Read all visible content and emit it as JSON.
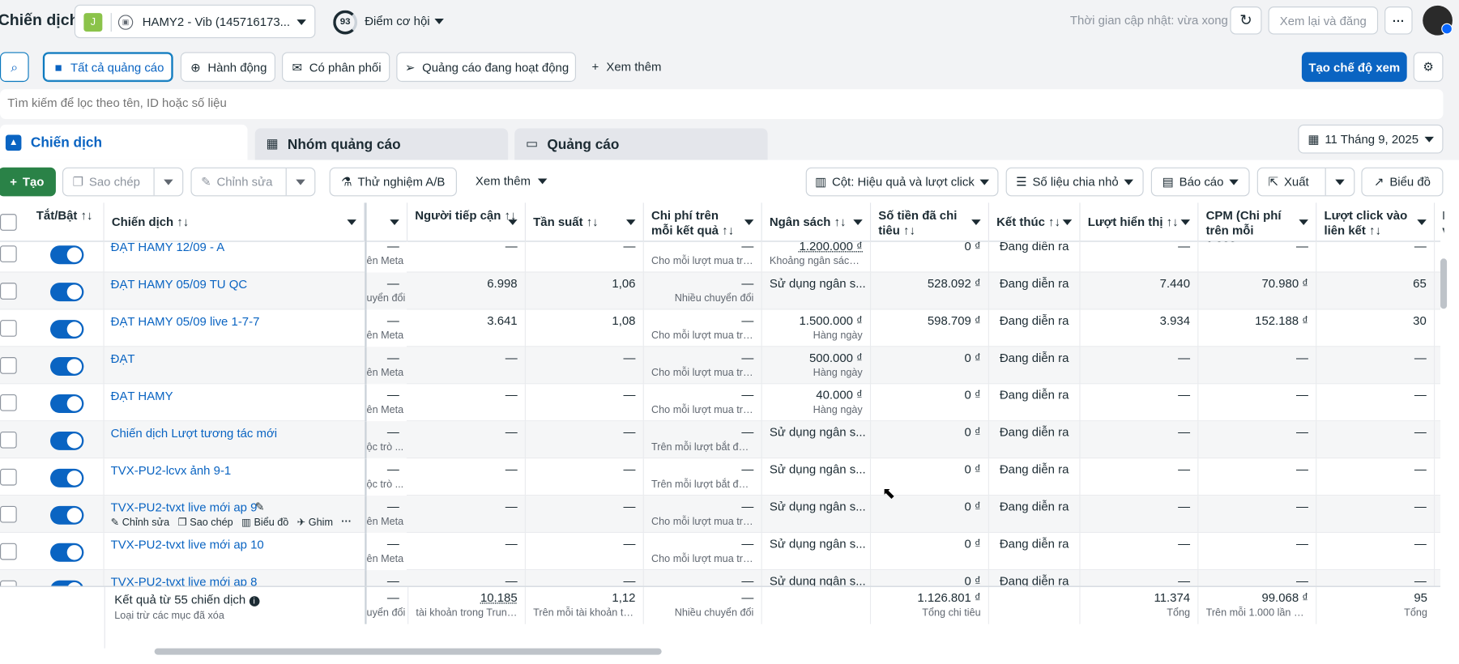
{
  "header": {
    "title": "Chiến dịch",
    "account_initial": "J",
    "account_name": "HAMY2 - Vib (145716173...",
    "score": "93",
    "opportunity_label": "Điểm cơ hội",
    "update_status": "Thời gian cập nhật: vừa xong",
    "review_button": "Xem lại và đăng",
    "more_button": "···"
  },
  "filters": {
    "all_ads": "Tất cả quảng cáo",
    "actions": "Hành động",
    "delivery": "Có phân phối",
    "active_ads": "Quảng cáo đang hoạt động",
    "see_more": "Xem thêm",
    "create_view": "Tạo chế độ xem"
  },
  "search": {
    "placeholder": "Tìm kiếm để lọc theo tên, ID hoặc số liệu"
  },
  "tabs": {
    "campaigns": "Chiến dịch",
    "ad_sets": "Nhóm quảng cáo",
    "ads": "Quảng cáo"
  },
  "date_picker": "11 Tháng 9, 2025",
  "toolbar": {
    "create": "Tạo",
    "duplicate": "Sao chép",
    "edit": "Chỉnh sửa",
    "ab_test": "Thử nghiệm A/B",
    "more": "Xem thêm",
    "columns": "Cột: Hiệu quả và lượt click",
    "breakdown": "Số liệu chia nhỏ",
    "reports": "Báo cáo",
    "export": "Xuất",
    "chart": "Biểu đồ"
  },
  "columns": {
    "toggle": "Tắt/Bật ↑↓",
    "campaign": "Chiến dịch ↑↓",
    "reach": "Người tiếp cận ↑↓",
    "frequency": "Tần suất ↑↓",
    "cost_per_result": "Chi phí trên mỗi kết quả ↑↓",
    "budget": "Ngân sách ↑↓",
    "amount_spent": "Số tiền đã chi tiêu ↑↓",
    "ends": "Kết thúc ↑↓",
    "impressions": "Lượt hiển thị ↑↓",
    "cpm": "CPM (Chi phí trên mỗi 1.000...",
    "link_clicks": "Lượt click vào liên kết ↑↓",
    "next": "L v"
  },
  "rows": [
    {
      "name": "ĐẠT HAMY 12/09 - A",
      "ra": "—",
      "ra_sub": "ên Meta",
      "reach": "—",
      "freq": "—",
      "cpr": "—",
      "cpr_sub": "Cho mỗi lượt mua trê...",
      "budget": "1.200.000 ₫",
      "budget_sub": "Khoảng ngân sách ...",
      "spent": "0 ₫",
      "ends": "Đang diễn ra",
      "impr": "—",
      "cpm": "—",
      "clicks": "—"
    },
    {
      "name": "ĐẠT HAMY 05/09 TU QC",
      "ra": "—",
      "ra_sub": "uyển đổi",
      "reach": "6.998",
      "freq": "1,06",
      "cpr": "—",
      "cpr_sub": "Nhiều chuyển đổi",
      "budget": "Sử dụng ngân s...",
      "budget_sub": "",
      "spent": "528.092 ₫",
      "ends": "Đang diễn ra",
      "impr": "7.440",
      "cpm": "70.980 ₫",
      "clicks": "65"
    },
    {
      "name": "ĐẠT HAMY 05/09 live 1-7-7",
      "ra": "—",
      "ra_sub": "ên Meta",
      "reach": "3.641",
      "freq": "1,08",
      "cpr": "—",
      "cpr_sub": "Cho mỗi lượt mua trê...",
      "budget": "1.500.000 ₫",
      "budget_sub": "Hàng ngày",
      "spent": "598.709 ₫",
      "ends": "Đang diễn ra",
      "impr": "3.934",
      "cpm": "152.188 ₫",
      "clicks": "30"
    },
    {
      "name": "ĐẠT",
      "ra": "—",
      "ra_sub": "ên Meta",
      "reach": "—",
      "freq": "—",
      "cpr": "—",
      "cpr_sub": "Cho mỗi lượt mua trê...",
      "budget": "500.000 ₫",
      "budget_sub": "Hàng ngày",
      "spent": "0 ₫",
      "ends": "Đang diễn ra",
      "impr": "—",
      "cpm": "—",
      "clicks": "—"
    },
    {
      "name": "ĐẠT HAMY",
      "ra": "—",
      "ra_sub": "ên Meta",
      "reach": "—",
      "freq": "—",
      "cpr": "—",
      "cpr_sub": "Cho mỗi lượt mua trê...",
      "budget": "40.000 ₫",
      "budget_sub": "Hàng ngày",
      "spent": "0 ₫",
      "ends": "Đang diễn ra",
      "impr": "—",
      "cpm": "—",
      "clicks": "—"
    },
    {
      "name": "Chiến dịch Lượt tương tác mới",
      "ra": "—",
      "ra_sub": "ộc trò ...",
      "reach": "—",
      "freq": "—",
      "cpr": "—",
      "cpr_sub": "Trên mỗi lượt bắt đầu ...",
      "budget": "Sử dụng ngân s...",
      "budget_sub": "",
      "spent": "0 ₫",
      "ends": "Đang diễn ra",
      "impr": "—",
      "cpm": "—",
      "clicks": "—"
    },
    {
      "name": "TVX-PU2-lcvx ảnh 9-1",
      "ra": "—",
      "ra_sub": "ộc trò ...",
      "reach": "—",
      "freq": "—",
      "cpr": "—",
      "cpr_sub": "Trên mỗi lượt bắt đầu ...",
      "budget": "Sử dụng ngân s...",
      "budget_sub": "",
      "spent": "0 ₫",
      "ends": "Đang diễn ra",
      "impr": "—",
      "cpm": "—",
      "clicks": "—"
    },
    {
      "name": "TVX-PU2-tvxt live mới ap 9",
      "ra": "—",
      "ra_sub": "ên Meta",
      "reach": "—",
      "freq": "—",
      "cpr": "—",
      "cpr_sub": "Cho mỗi lượt mua trê...",
      "budget": "Sử dụng ngân s...",
      "budget_sub": "",
      "spent": "0 ₫",
      "ends": "Đang diễn ra",
      "impr": "—",
      "cpm": "—",
      "clicks": "—"
    },
    {
      "name": "TVX-PU2-tvxt live mới ap 10",
      "ra": "—",
      "ra_sub": "ên Meta",
      "reach": "—",
      "freq": "—",
      "cpr": "—",
      "cpr_sub": "Cho mỗi lượt mua trê...",
      "budget": "Sử dụng ngân s...",
      "budget_sub": "",
      "spent": "0 ₫",
      "ends": "Đang diễn ra",
      "impr": "—",
      "cpm": "—",
      "clicks": "—"
    },
    {
      "name": "TVX-PU2-tvxt live mới ap 8",
      "ra": "—",
      "ra_sub": "",
      "reach": "—",
      "freq": "—",
      "cpr": "—",
      "cpr_sub": "",
      "budget": "Sử dụng ngân s...",
      "budget_sub": "",
      "spent": "0 ₫",
      "ends": "Đang diễn ra",
      "impr": "—",
      "cpm": "—",
      "clicks": "—"
    }
  ],
  "row_actions": {
    "edit": "Chỉnh sửa",
    "duplicate": "Sao chép",
    "chart": "Biểu đồ",
    "pin": "Ghim"
  },
  "footer": {
    "label": "Kết quả từ 55 chiến dịch",
    "sub": "Loại trừ các mục đã xóa",
    "ra": "—",
    "ra_sub": "uyển đổi",
    "reach": "10.185",
    "reach_sub": "tài khoản trong Trung ...",
    "freq": "1,12",
    "freq_sub": "Trên mỗi tài khoản tro...",
    "cpr": "—",
    "cpr_sub": "Nhiều chuyển đổi",
    "spent": "1.126.801 ₫",
    "spent_sub": "Tổng chi tiêu",
    "impr": "11.374",
    "impr_sub": "Tổng",
    "cpm": "99.068 ₫",
    "cpm_sub": "Trên mỗi 1.000 lần hiể...",
    "clicks": "95",
    "clicks_sub": "Tổng"
  },
  "colors": {
    "accent": "#0a64c2",
    "toggle_on": "#0a64c2",
    "selected_border": "#0a78be"
  }
}
